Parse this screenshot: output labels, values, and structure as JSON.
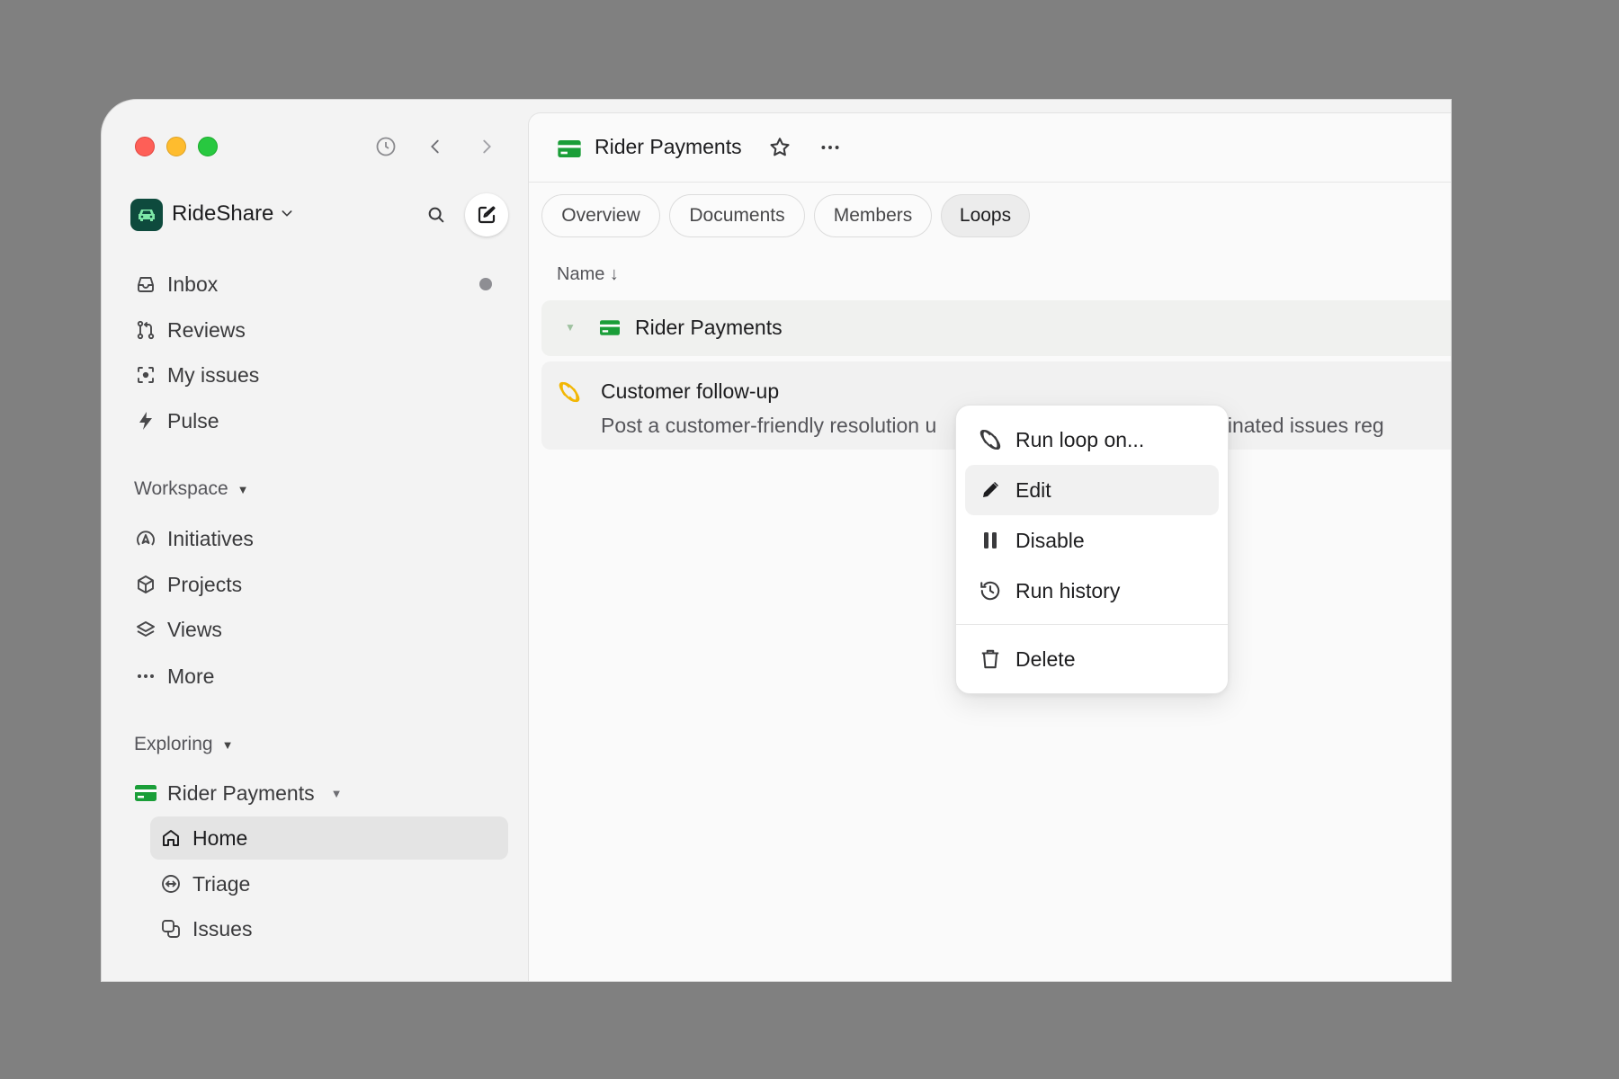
{
  "workspace": {
    "name": "RideShare"
  },
  "sidebar": {
    "nav": [
      {
        "label": "Inbox",
        "icon": "inbox-icon"
      },
      {
        "label": "Reviews",
        "icon": "pull-request-icon"
      },
      {
        "label": "My issues",
        "icon": "focus-icon"
      },
      {
        "label": "Pulse",
        "icon": "pulse-icon"
      }
    ],
    "workspace_section": {
      "title": "Workspace",
      "items": [
        {
          "label": "Initiatives",
          "icon": "initiatives-icon"
        },
        {
          "label": "Projects",
          "icon": "cube-icon"
        },
        {
          "label": "Views",
          "icon": "layers-icon"
        },
        {
          "label": "More",
          "icon": "ellipsis-icon"
        }
      ]
    },
    "exploring_section": {
      "title": "Exploring",
      "team": {
        "label": "Rider Payments",
        "icon": "credit-card-icon"
      },
      "sub_items": [
        {
          "label": "Home",
          "icon": "home-icon",
          "active": true
        },
        {
          "label": "Triage",
          "icon": "triage-icon",
          "active": false
        },
        {
          "label": "Issues",
          "icon": "issues-icon",
          "active": false
        }
      ]
    }
  },
  "header": {
    "title": "Rider Payments"
  },
  "tabs": [
    {
      "label": "Overview",
      "active": false
    },
    {
      "label": "Documents",
      "active": false
    },
    {
      "label": "Members",
      "active": false
    },
    {
      "label": "Loops",
      "active": true
    }
  ],
  "list": {
    "sort_label": "Name ↓",
    "group": {
      "title": "Rider Payments"
    },
    "rows": [
      {
        "title": "Customer follow-up",
        "description_left": "Post a customer-friendly resolution u",
        "description_right": "riginated issues reg"
      }
    ]
  },
  "context_menu": {
    "items": [
      {
        "label": "Run loop on...",
        "icon": "loop-icon",
        "highlighted": false
      },
      {
        "label": "Edit",
        "icon": "pencil-icon",
        "highlighted": true
      },
      {
        "label": "Disable",
        "icon": "pause-icon",
        "highlighted": false
      },
      {
        "label": "Run history",
        "icon": "history-icon",
        "highlighted": false
      },
      {
        "label": "Delete",
        "icon": "trash-icon",
        "highlighted": false
      }
    ]
  },
  "colors": {
    "brand_green": "#1a9e38",
    "loop_yellow": "#f2b705",
    "workspace_logo_bg": "#0e4a3d"
  }
}
